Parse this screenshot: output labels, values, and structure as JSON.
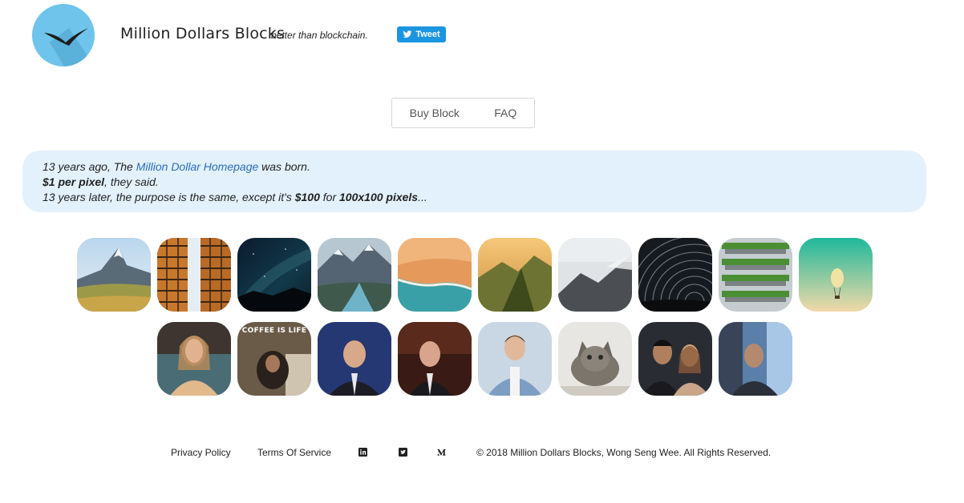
{
  "header": {
    "brand": "Million Dollars Blocks",
    "tagline": "better than blockchain.",
    "tweet_label": "Tweet",
    "colors": {
      "logo_bg": "#6ec4ea",
      "tweet_bg": "#1b95e0"
    }
  },
  "nav": {
    "items": [
      {
        "label": "Buy Block"
      },
      {
        "label": "FAQ"
      }
    ]
  },
  "intro": {
    "line1_pre": "13 years ago, The ",
    "line1_link": "Million Dollar Homepage",
    "line1_post": " was born.",
    "line2_bold": "$1 per pixel",
    "line2_post": ", they said.",
    "line3_pre": "13 years later, the purpose is the same, except it's ",
    "line3_price": "$100",
    "line3_mid": " for ",
    "line3_pixels": "100x100 pixels",
    "line3_post": "..."
  },
  "blocks": {
    "row1": [
      "mountain-peak",
      "glass-building",
      "night-sky",
      "valley-river",
      "beach-aerial",
      "mountain-ridge",
      "misty-mountain",
      "star-trails",
      "green-building",
      "balloon"
    ],
    "row2": [
      "woman-gif",
      "coffee-is-life-gif",
      "host-gif",
      "shark-tank-gif",
      "man-thumbs-up-gif",
      "cat-gif",
      "couple-gif",
      "street-gif"
    ],
    "row2_caption": "COFFEE IS LIFE"
  },
  "footer": {
    "privacy": "Privacy Policy",
    "terms": "Terms Of Service",
    "icons": [
      "linkedin-icon",
      "twitter-icon",
      "medium-icon"
    ],
    "copyright": "© 2018 Million Dollars Blocks, Wong Seng Wee. All Rights Reserved."
  }
}
